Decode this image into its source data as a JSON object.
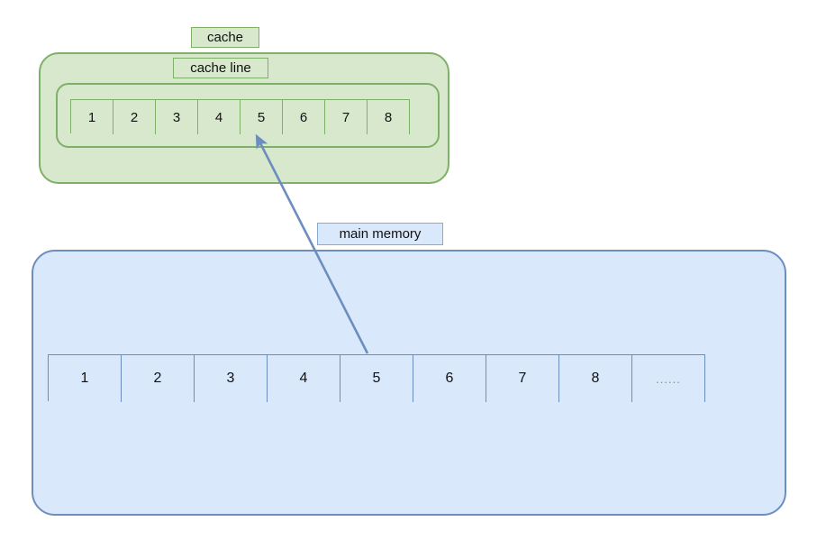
{
  "diagram": {
    "title_labels": {
      "cache": "cache",
      "cache_line": "cache line",
      "main_memory": "main memory"
    },
    "cache": {
      "label": "cache",
      "cache_line": {
        "label": "cache line",
        "cells": [
          "1",
          "2",
          "3",
          "4",
          "5",
          "6",
          "7",
          "8"
        ]
      },
      "colors": {
        "fill": "#d7e8cd",
        "stroke": "#7fb069"
      }
    },
    "main_memory": {
      "label": "main memory",
      "cells": [
        "1",
        "2",
        "3",
        "4",
        "5",
        "6",
        "7",
        "8",
        "......"
      ],
      "colors": {
        "fill": "#dae8fc",
        "stroke": "#6c8ebf"
      }
    },
    "arrow": {
      "name": "memory-to-cache-arrow",
      "from_cell": "5",
      "to_cell": "5",
      "color": "#6c8ebf"
    }
  }
}
